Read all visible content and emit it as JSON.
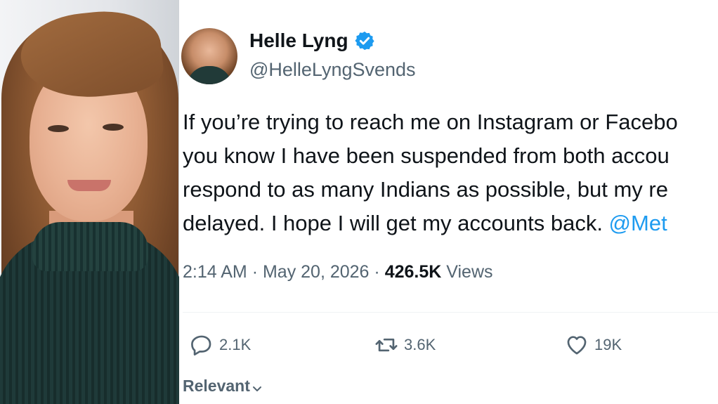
{
  "profile": {
    "display_name": "Helle Lyng",
    "handle": "@HelleLyngSvends",
    "verified": true,
    "verified_badge_color": "#1d9bf0"
  },
  "tweet": {
    "lines": [
      "If you’re trying to reach me on Instagram or Facebo",
      "you know I have been suspended from both accou",
      "respond to as many Indians as possible, but my re",
      "delayed. I hope I will get my accounts back. "
    ],
    "mention": "@Met",
    "mention_color": "#1d9bf0"
  },
  "meta": {
    "time": "2:14 AM",
    "separator": "·",
    "date": "May 20, 2026",
    "views_count": "426.5K",
    "views_label": "Views"
  },
  "actions": {
    "replies": {
      "icon": "reply-icon",
      "count": "2.1K"
    },
    "retweets": {
      "icon": "retweet-icon",
      "count": "3.6K"
    },
    "likes": {
      "icon": "heart-icon",
      "count": "19K"
    }
  },
  "replies_sort": {
    "label": "Relevant",
    "icon": "chevron-down-icon"
  },
  "colors": {
    "text_primary": "#0f1419",
    "text_secondary": "#536471",
    "accent": "#1d9bf0"
  }
}
